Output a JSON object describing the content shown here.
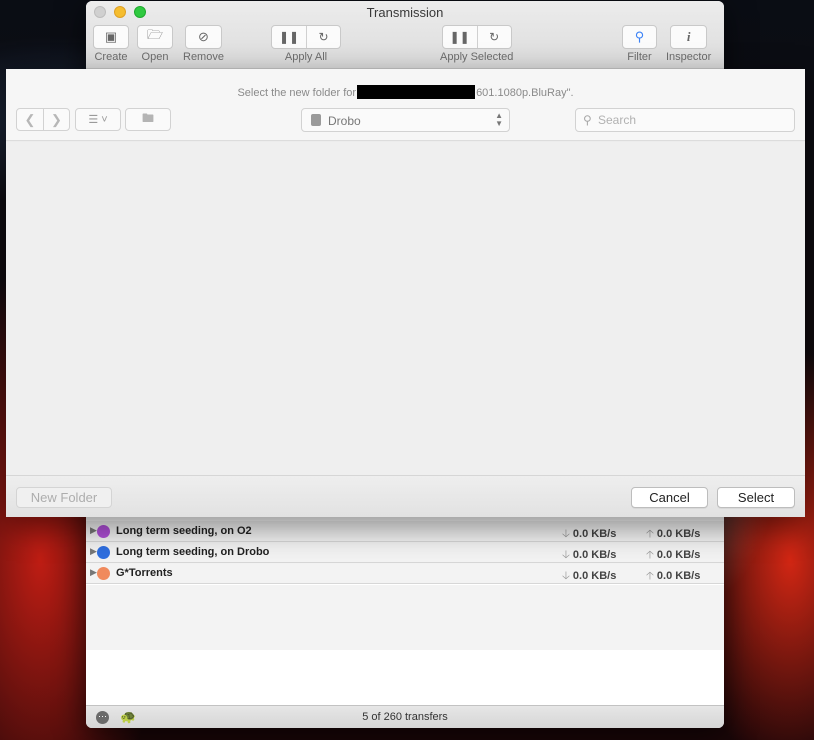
{
  "window": {
    "title": "Transmission"
  },
  "toolbar": {
    "create_label": "Create",
    "open_label": "Open",
    "remove_label": "Remove",
    "apply_all_label": "Apply All",
    "apply_selected_label": "Apply Selected",
    "filter_label": "Filter",
    "inspector_label": "Inspector"
  },
  "groups": [
    {
      "name": "Long term seeding, on O2",
      "color": "#b04fd8",
      "down": "0.0 KB/s",
      "up": "0.0 KB/s"
    },
    {
      "name": "Long term seeding, on Drobo",
      "color": "#2f6fe0",
      "down": "0.0 KB/s",
      "up": "0.0 KB/s"
    },
    {
      "name": "G*Torrents",
      "color": "#f08a5d",
      "down": "0.0 KB/s",
      "up": "0.0 KB/s"
    }
  ],
  "status": {
    "transfers": "5 of 260 transfers"
  },
  "dialog": {
    "message_before": "Select the new folder for",
    "message_after": "601.1080p.BluRay\".",
    "location": "Drobo",
    "search_placeholder": "Search",
    "new_folder_label": "New Folder",
    "cancel_label": "Cancel",
    "select_label": "Select"
  }
}
